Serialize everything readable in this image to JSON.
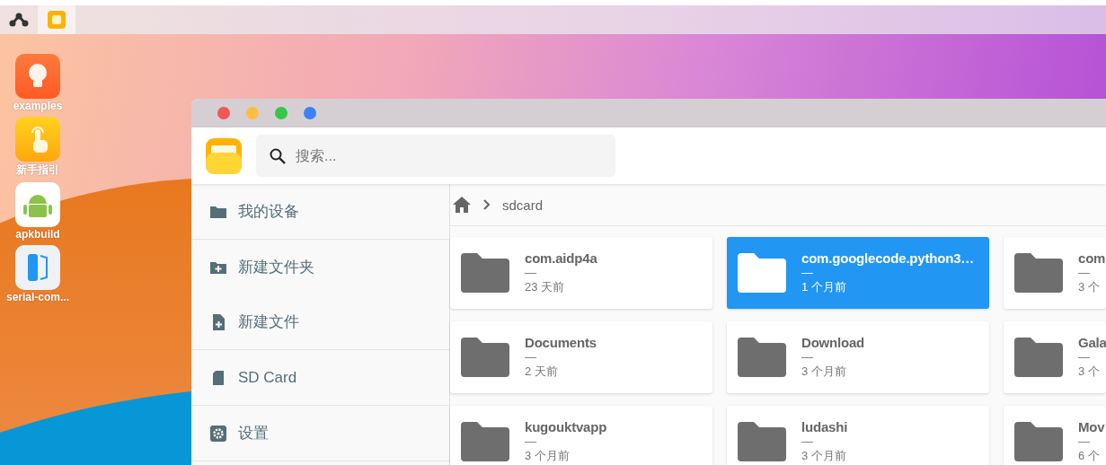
{
  "taskbar": {
    "items": [
      {
        "kind": "launcher",
        "selected": false
      },
      {
        "kind": "files",
        "selected": true
      }
    ]
  },
  "desktop_icons": [
    {
      "kind": "bulb",
      "label": "examples"
    },
    {
      "kind": "hand",
      "label": "新手指引"
    },
    {
      "kind": "android",
      "label": "apkbuild"
    },
    {
      "kind": "serial",
      "label": "serial-com..."
    }
  ],
  "window": {
    "search": {
      "placeholder": "搜索..."
    },
    "sidebar": {
      "sections": [
        {
          "items": [
            {
              "kind": "folder",
              "label": "我的设备"
            }
          ]
        },
        {
          "items": [
            {
              "kind": "new-folder",
              "label": "新建文件夹"
            },
            {
              "kind": "new-file",
              "label": "新建文件"
            }
          ]
        },
        {
          "items": [
            {
              "kind": "sd",
              "label": "SD Card"
            }
          ]
        },
        {
          "items": [
            {
              "kind": "settings",
              "label": "设置"
            }
          ]
        }
      ]
    },
    "breadcrumb": [
      "sdcard"
    ],
    "files": [
      {
        "name": "com.aidp4a",
        "detail": "—",
        "modified": "23 天前",
        "selected": false
      },
      {
        "name": "com.googlecode.python3…",
        "detail": "—",
        "modified": "1 个月前",
        "selected": true
      },
      {
        "name": "com",
        "detail": "—",
        "modified": "3 个",
        "selected": false
      },
      {
        "name": "Documents",
        "detail": "—",
        "modified": "2 天前",
        "selected": false
      },
      {
        "name": "Download",
        "detail": "—",
        "modified": "3 个月前",
        "selected": false
      },
      {
        "name": "Gala",
        "detail": "—",
        "modified": "3 个",
        "selected": false
      },
      {
        "name": "kugouktvapp",
        "detail": "—",
        "modified": "3 个月前",
        "selected": false
      },
      {
        "name": "ludashi",
        "detail": "—",
        "modified": "3 个月前",
        "selected": false
      },
      {
        "name": "Mov",
        "detail": "—",
        "modified": "6 个",
        "selected": false
      }
    ]
  }
}
